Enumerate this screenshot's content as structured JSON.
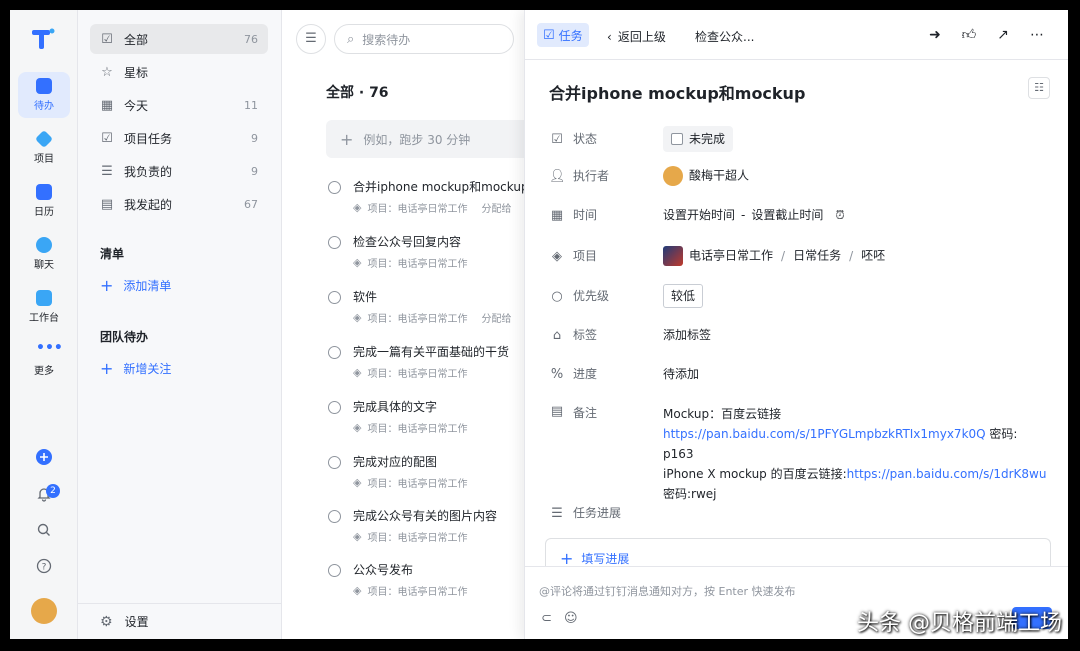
{
  "rail": {
    "items": [
      {
        "label": "待办",
        "icon": "todo-icon",
        "color": "#3370ff"
      },
      {
        "label": "项目",
        "icon": "project-icon",
        "color": "#3aa6f5"
      },
      {
        "label": "日历",
        "icon": "calendar-icon",
        "color": "#3370ff"
      },
      {
        "label": "聊天",
        "icon": "chat-icon",
        "color": "#3aa6f5"
      },
      {
        "label": "工作台",
        "icon": "workbench-icon",
        "color": "#3aa6f5"
      },
      {
        "label": "更多",
        "icon": "more-icon",
        "color": "#3370ff"
      }
    ],
    "notification_count": "2"
  },
  "nav": {
    "items": [
      {
        "label": "全部",
        "count": "76",
        "icon": "check-square-icon"
      },
      {
        "label": "星标",
        "count": "",
        "icon": "star-icon"
      },
      {
        "label": "今天",
        "count": "11",
        "icon": "calendar-today-icon"
      },
      {
        "label": "项目任务",
        "count": "9",
        "icon": "project-task-icon"
      },
      {
        "label": "我负责的",
        "count": "9",
        "icon": "list-icon"
      },
      {
        "label": "我发起的",
        "count": "67",
        "icon": "clipboard-icon"
      }
    ],
    "list_header": "清单",
    "add_list": "添加清单",
    "team_header": "团队待办",
    "add_follow": "新增关注",
    "settings": "设置"
  },
  "list": {
    "search_placeholder": "搜索待办",
    "title": "全部 · 76",
    "quick_add_placeholder": "例如，跑步 30 分钟",
    "tasks": [
      {
        "title": "合并iphone mockup和mockup",
        "meta": "项目：电话亭日常工作",
        "extra": "分配给"
      },
      {
        "title": "检查公众号回复内容",
        "meta": "项目：电话亭日常工作",
        "extra": ""
      },
      {
        "title": "软件",
        "meta": "项目：电话亭日常工作",
        "extra": "分配给"
      },
      {
        "title": "完成一篇有关平面基础的干货",
        "meta": "项目：电话亭日常工作",
        "extra": ""
      },
      {
        "title": "完成具体的文字",
        "meta": "项目：电话亭日常工作",
        "extra": ""
      },
      {
        "title": "完成对应的配图",
        "meta": "项目：电话亭日常工作",
        "extra": ""
      },
      {
        "title": "完成公众号有关的图片内容",
        "meta": "项目：电话亭日常工作",
        "extra": ""
      },
      {
        "title": "公众号发布",
        "meta": "项目：电话亭日常工作",
        "extra": ""
      }
    ]
  },
  "detail": {
    "tab": "任务",
    "back": "返回上级",
    "crumb": "检查公众...",
    "title": "合并iphone mockup和mockup",
    "status_label": "状态",
    "status_value": "未完成",
    "assignee_label": "执行者",
    "assignee_value": "酸梅干超人",
    "time_label": "时间",
    "time_start": "设置开始时间",
    "time_dash": "-",
    "time_end": "设置截止时间",
    "project_label": "项目",
    "project_name": "电话亭日常工作",
    "project_group": "日常任务",
    "project_sub": "呸呸",
    "priority_label": "优先级",
    "priority_value": "较低",
    "tag_label": "标签",
    "tag_value": "添加标签",
    "progress_label": "进度",
    "progress_value": "待添加",
    "note_label": "备注",
    "note_line1": "Mockup：百度云链接",
    "note_link1": "https://pan.baidu.com/s/1PFYGLmpbzkRTIx1myx7k0Q",
    "note_pwd1": " 密码: p163",
    "note_line3_prefix": "iPhone X mockup 的百度云链接:",
    "note_link2": "https://pan.baidu.com/s/1drK8wu",
    "note_pwd2": "密码:rwej",
    "task_progress_label": "任务进展",
    "write_progress": "填写进展",
    "comment_placeholder": "@评论将通过钉钉消息通知对方，按 Enter 快速发布"
  },
  "watermark": "头条 @贝格前端工场",
  "colors": {
    "accent": "#3370ff",
    "text": "#1f2329",
    "muted": "#8f959e"
  }
}
